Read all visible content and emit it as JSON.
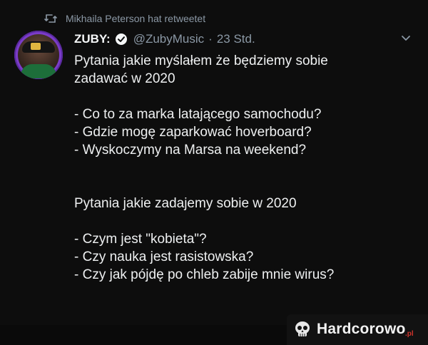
{
  "retweet": {
    "icon": "retweet-icon",
    "text": "Mikhaila Peterson hat retweetet"
  },
  "author": {
    "avatar": "avatar",
    "name": "ZUBY:",
    "verified_icon": "verified-badge-icon",
    "handle": "@ZubyMusic",
    "separator": "·",
    "time": "23 Std."
  },
  "menu": {
    "icon": "chevron-down-icon"
  },
  "tweet": {
    "lines": [
      "Pytania jakie myślałem że będziemy sobie",
      "zadawać w 2020",
      "",
      "- Co to za marka latającego samochodu?",
      "- Gdzie mogę zaparkować hoverboard?",
      "- Wyskoczymy na Marsa na weekend?",
      "",
      "",
      "Pytania jakie zadajemy sobie w 2020",
      "",
      "- Czym jest \"kobieta\"?",
      "- Czy nauka jest rasistowska?",
      "- Czy jak pójdę po chleb zabije mnie wirus?"
    ]
  },
  "watermark": {
    "icon": "skull-logo-icon",
    "text": "Hardcorowo",
    "suffix": ".pl"
  },
  "colors": {
    "background": "#0d0d0d",
    "text": "#eef0f1",
    "muted": "#8b98a5",
    "verified": "#ffffff",
    "avatar_ring": "#7b3cc9",
    "watermark_accent": "#d0342c"
  }
}
